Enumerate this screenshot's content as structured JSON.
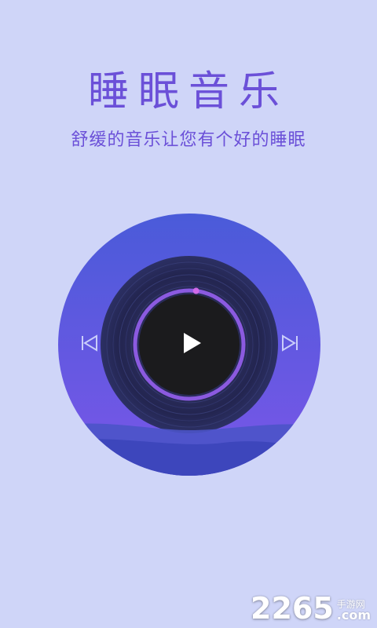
{
  "header": {
    "title": "睡眠音乐",
    "subtitle": "舒缓的音乐让您有个好的睡眠"
  },
  "player": {
    "controls": {
      "previous": "previous-icon",
      "play": "play-icon",
      "next": "next-icon"
    },
    "progress": 0.02
  },
  "watermark": {
    "main": "2265",
    "cn": "手游网",
    "domain": ".com"
  },
  "colors": {
    "background": "#cfd5f8",
    "accent": "#6b50d8",
    "circle_top": "#4b5ad8",
    "circle_bottom": "#7a55e6",
    "record": "#23254d",
    "label": "#1b1b1d"
  }
}
